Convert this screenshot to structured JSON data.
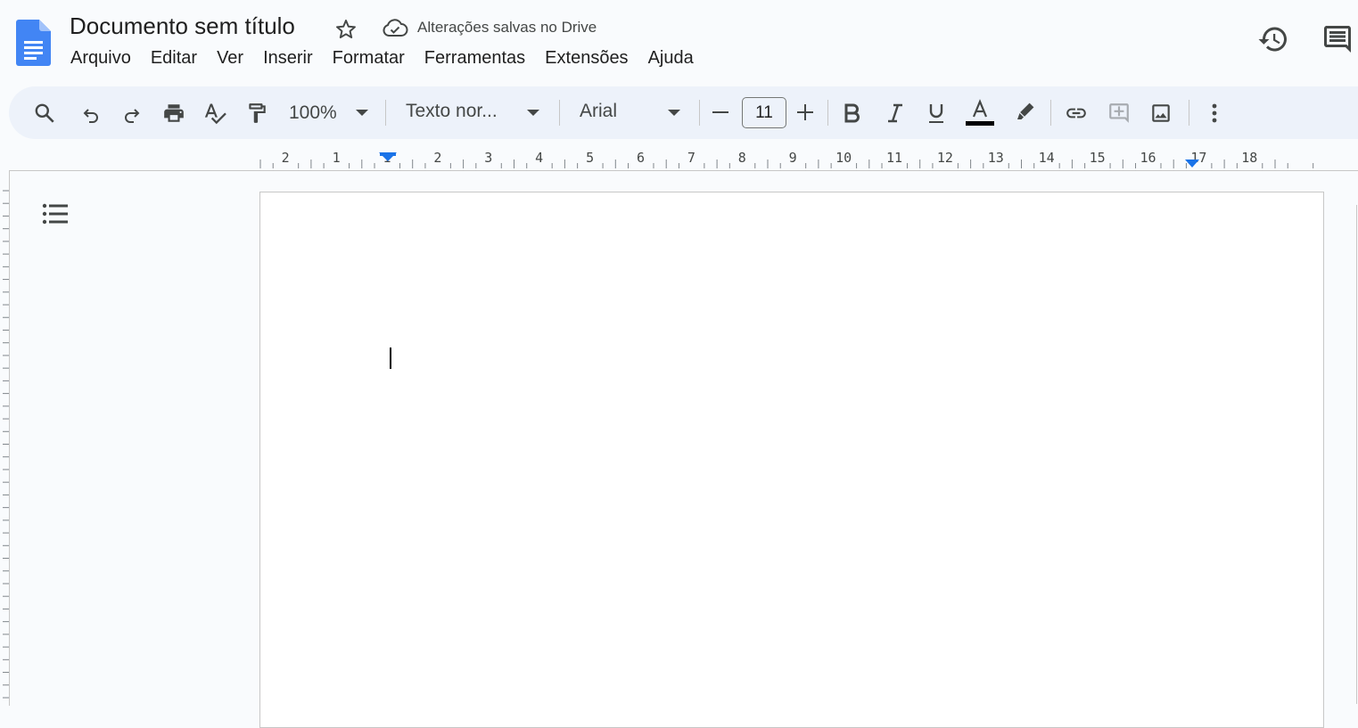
{
  "app": {
    "doc_title": "Documento sem título",
    "save_status": "Alterações salvas no Drive"
  },
  "menu": [
    "Arquivo",
    "Editar",
    "Ver",
    "Inserir",
    "Formatar",
    "Ferramentas",
    "Extensões",
    "Ajuda"
  ],
  "toolbar": {
    "zoom": "100%",
    "paragraph_style": "Texto nor...",
    "font": "Arial",
    "font_size": "11",
    "text_color": "#000000"
  },
  "ruler": {
    "labels": [
      "2",
      "1",
      "1",
      "2",
      "3",
      "4",
      "5",
      "6",
      "7",
      "8",
      "9",
      "10",
      "11",
      "12",
      "13",
      "14",
      "15",
      "16",
      "17",
      "18"
    ]
  },
  "colors": {
    "accent": "#1a73e8",
    "toolbar_bg": "#edf2fa",
    "page_bg": "#f9fbfd"
  },
  "icons": {
    "logo": "google-docs-icon",
    "star": "star-icon",
    "cloud": "cloud-done-icon",
    "history": "history-icon",
    "comments": "comments-icon",
    "outline": "outline-list-icon"
  }
}
